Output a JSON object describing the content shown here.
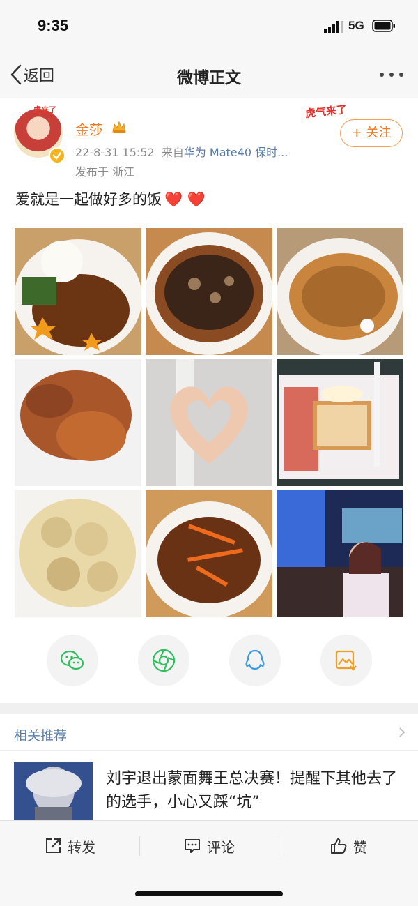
{
  "status_bar": {
    "time": "9:35",
    "network": "5G"
  },
  "nav": {
    "back_label": "返回",
    "title": "微博正文"
  },
  "author": {
    "name": "金莎",
    "timestamp": "22-8-31 15:52",
    "source_prefix": "来自",
    "source_device": "华为 Mate40 保时...",
    "location": "发布于 浙江",
    "avatar_badge": "虎来了",
    "festive_badge": "虎气来了",
    "follow_label": "+ 关注"
  },
  "post": {
    "text": "爱就是一起做好多的饭",
    "hearts": "❤️ ❤️"
  },
  "photos": [
    {
      "name": "photo-rice-plate"
    },
    {
      "name": "photo-eggplant-plate"
    },
    {
      "name": "photo-fried-rice"
    },
    {
      "name": "photo-fried-chicken"
    },
    {
      "name": "photo-hand-heart"
    },
    {
      "name": "photo-toast-breakfast"
    },
    {
      "name": "photo-fried-tofu"
    },
    {
      "name": "photo-pork-carrot"
    },
    {
      "name": "photo-woman-aquarium"
    }
  ],
  "share": [
    {
      "name": "wechat-icon"
    },
    {
      "name": "moments-icon"
    },
    {
      "name": "qq-icon"
    },
    {
      "name": "save-image-icon"
    }
  ],
  "recommend": {
    "header": "相关推荐",
    "item_text": "刘宇退出蒙面舞王总决赛！提醒下其他去了的选手，小心又踩“坑”"
  },
  "tabbar": {
    "repost": "转发",
    "comment": "评论",
    "like": "赞"
  },
  "colors": {
    "accent_orange": "#f07820",
    "link_blue": "#5a7ea8",
    "badge_red": "#e2302a"
  }
}
